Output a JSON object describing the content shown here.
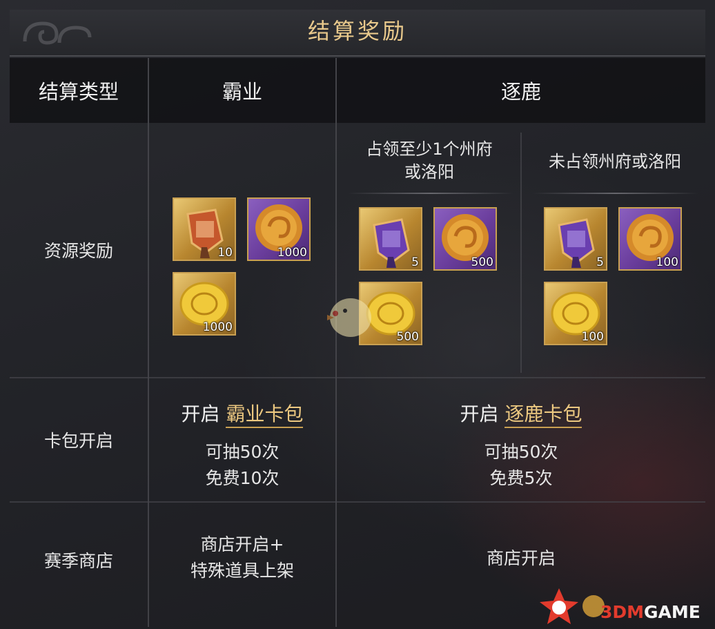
{
  "title": "结算奖励",
  "header": {
    "col_type": "结算类型",
    "col_baye": "霸业",
    "col_zhulu": "逐鹿"
  },
  "zhulu_subheaders": {
    "occupied": "占领至少1个州府\n或洛阳",
    "not_occupied": "未占领州府或洛阳"
  },
  "rows": {
    "resources": "资源奖励",
    "card_pack": "卡包开启",
    "season_shop": "赛季商店"
  },
  "rewards": {
    "baye": [
      {
        "icon": "baye-token-icon",
        "count": "10",
        "bg": "gold"
      },
      {
        "icon": "jade-coin-icon",
        "count": "1000",
        "bg": "purple"
      },
      {
        "icon": "gold-coin-icon",
        "count": "1000",
        "bg": "gold"
      }
    ],
    "zhulu_occupied": [
      {
        "icon": "zhulu-token-icon",
        "count": "5",
        "bg": "gold"
      },
      {
        "icon": "jade-coin-icon",
        "count": "500",
        "bg": "purple"
      },
      {
        "icon": "gold-coin-icon",
        "count": "500",
        "bg": "gold"
      }
    ],
    "zhulu_not_occupied": [
      {
        "icon": "zhulu-token-icon",
        "count": "5",
        "bg": "gold"
      },
      {
        "icon": "jade-coin-icon",
        "count": "100",
        "bg": "purple"
      },
      {
        "icon": "gold-coin-icon",
        "count": "100",
        "bg": "gold"
      }
    ]
  },
  "card_pack": {
    "baye": {
      "prefix": "开启",
      "pack": "霸业卡包",
      "draws": "可抽50次",
      "free": "免费10次"
    },
    "zhulu": {
      "prefix": "开启",
      "pack": "逐鹿卡包",
      "draws": "可抽50次",
      "free": "免费5次"
    }
  },
  "season_shop": {
    "baye": "商店开启+\n特殊道具上架",
    "zhulu": "商店开启"
  },
  "watermark": {
    "brand_red": "3DM",
    "brand_white": "GAME"
  },
  "colors": {
    "accent_gold": "#e9c98c",
    "item_border": "#c9a052",
    "item_purple": "#6a3d9c"
  }
}
